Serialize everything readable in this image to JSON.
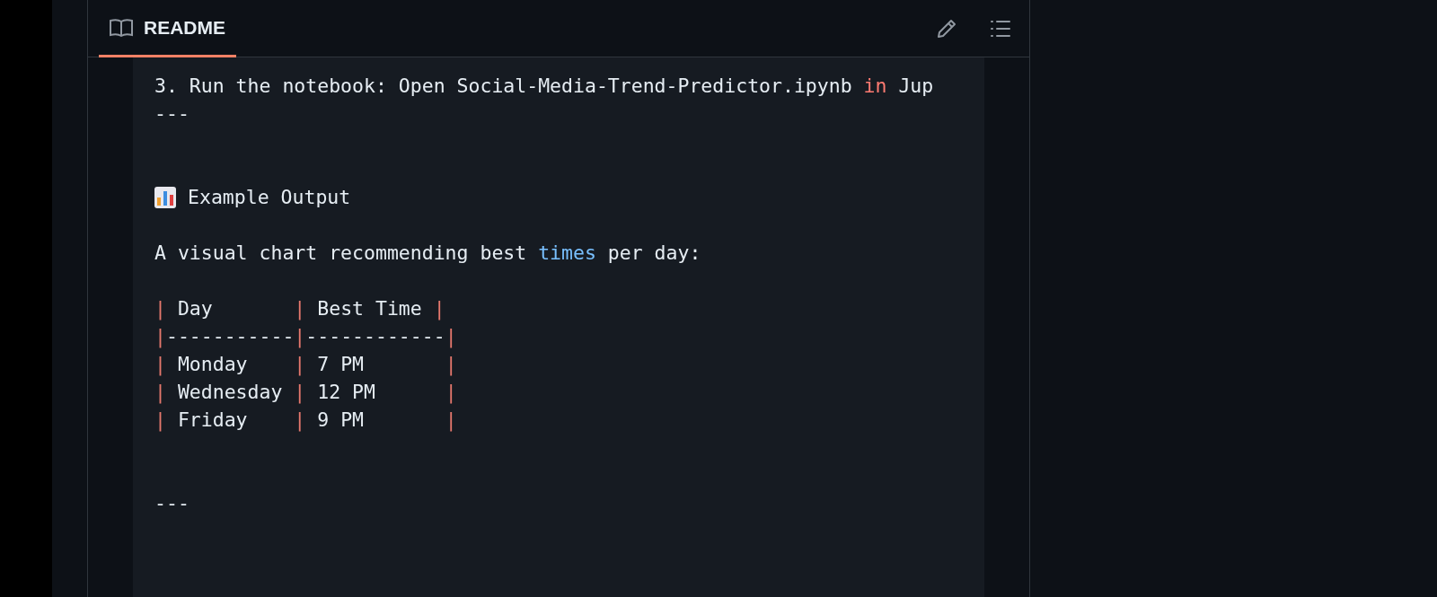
{
  "readme": {
    "tabs": [
      {
        "label": "README",
        "selected": true
      }
    ],
    "lines": [
      {
        "kind": "text",
        "segments": [
          {
            "text": "3. Run the notebook: Open Social-Media-Trend-Predictor.ipynb ",
            "kind": "plain"
          },
          {
            "text": "in",
            "kind": "keyword"
          },
          {
            "text": " Jup",
            "kind": "plain"
          }
        ]
      },
      {
        "kind": "text",
        "segments": [
          {
            "text": "---",
            "kind": "plain"
          }
        ]
      },
      {
        "kind": "blank"
      },
      {
        "kind": "blank"
      },
      {
        "kind": "heading",
        "segments": [
          {
            "text": "Example Output",
            "kind": "plain"
          }
        ]
      },
      {
        "kind": "blank"
      },
      {
        "kind": "text",
        "segments": [
          {
            "text": "A visual chart recommending best ",
            "kind": "plain"
          },
          {
            "text": "times",
            "kind": "variable"
          },
          {
            "text": " per day:",
            "kind": "plain"
          }
        ]
      },
      {
        "kind": "blank"
      },
      {
        "kind": "text",
        "segments": [
          {
            "text": "|",
            "kind": "punct"
          },
          {
            "text": " Day       ",
            "kind": "plain"
          },
          {
            "text": "|",
            "kind": "punct"
          },
          {
            "text": " Best Time ",
            "kind": "plain"
          },
          {
            "text": "|",
            "kind": "punct"
          }
        ]
      },
      {
        "kind": "text",
        "segments": [
          {
            "text": "|",
            "kind": "punct"
          },
          {
            "text": "-----------",
            "kind": "plain"
          },
          {
            "text": "|",
            "kind": "punct"
          },
          {
            "text": "------------",
            "kind": "plain"
          },
          {
            "text": "|",
            "kind": "punct"
          }
        ]
      },
      {
        "kind": "text",
        "segments": [
          {
            "text": "|",
            "kind": "punct"
          },
          {
            "text": " Monday    ",
            "kind": "plain"
          },
          {
            "text": "|",
            "kind": "punct"
          },
          {
            "text": " 7 PM       ",
            "kind": "plain"
          },
          {
            "text": "|",
            "kind": "punct"
          }
        ]
      },
      {
        "kind": "text",
        "segments": [
          {
            "text": "|",
            "kind": "punct"
          },
          {
            "text": " Wednesday ",
            "kind": "plain"
          },
          {
            "text": "|",
            "kind": "punct"
          },
          {
            "text": " 12 PM      ",
            "kind": "plain"
          },
          {
            "text": "|",
            "kind": "punct"
          }
        ]
      },
      {
        "kind": "text",
        "segments": [
          {
            "text": "|",
            "kind": "punct"
          },
          {
            "text": " Friday    ",
            "kind": "plain"
          },
          {
            "text": "|",
            "kind": "punct"
          },
          {
            "text": " 9 PM       ",
            "kind": "plain"
          },
          {
            "text": "|",
            "kind": "punct"
          }
        ]
      },
      {
        "kind": "blank"
      },
      {
        "kind": "blank"
      },
      {
        "kind": "text",
        "segments": [
          {
            "text": "---",
            "kind": "plain"
          }
        ]
      }
    ]
  }
}
